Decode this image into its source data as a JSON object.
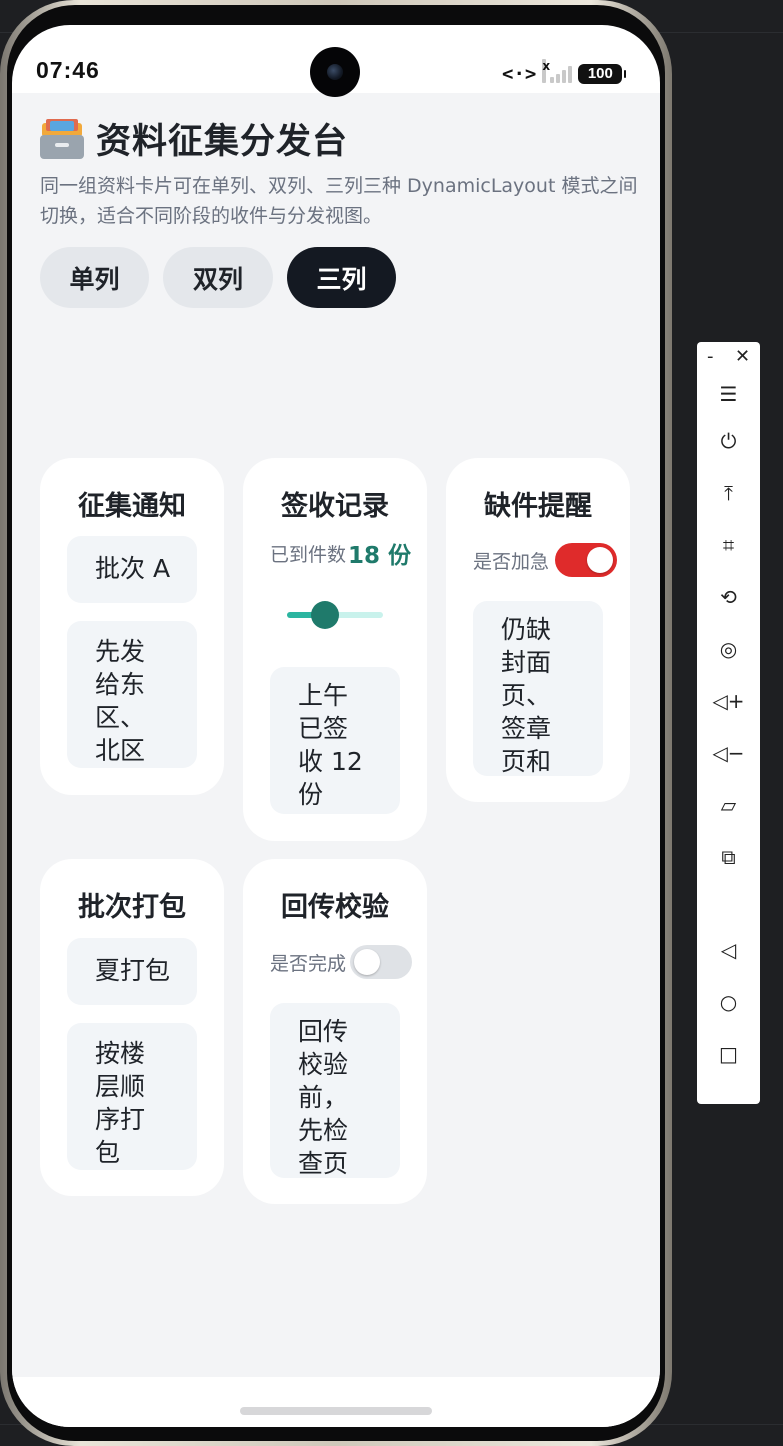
{
  "status_bar": {
    "time": "07:46",
    "network_icon": "<·>",
    "signal_x": "x",
    "battery": "100"
  },
  "header": {
    "icon": "card-file-box-icon",
    "title": "资料征集分发台",
    "subtitle": "同一组资料卡片可在单列、双列、三列三种 DynamicLayout 模式之间切换，适合不同阶段的收件与分发视图。"
  },
  "layout_buttons": [
    {
      "label": "单列",
      "selected": false
    },
    {
      "label": "双列",
      "selected": false
    },
    {
      "label": "三列",
      "selected": true
    }
  ],
  "cards": {
    "notice": {
      "title": "征集通知",
      "item1": "批次 A",
      "item2": "先发给东区、北区"
    },
    "receipt": {
      "title": "签收记录",
      "count_label": "已到件数",
      "count_value": "18 份",
      "slider_value": 0.35,
      "item1": "上午已签收 12 份"
    },
    "missing": {
      "title": "缺件提醒",
      "urgent_label": "是否加急",
      "urgent_on": true,
      "item1": "仍缺封面页、签章页和"
    },
    "packing": {
      "title": "批次打包",
      "item1": "夏打包",
      "item2": "按楼层顺序打包"
    },
    "verify": {
      "title": "回传校验",
      "done_label": "是否完成",
      "done_on": false,
      "item1": "回传校验前，先检查页"
    }
  },
  "emulator_toolbar": {
    "minimize": "-",
    "close": "✕",
    "buttons": [
      "menu-icon",
      "power-icon",
      "pin-top-icon",
      "crop-icon",
      "rotate-icon",
      "screenshot-icon",
      "volume-up-icon",
      "volume-down-icon",
      "shake-icon",
      "multi-device-icon",
      "back-icon",
      "home-icon",
      "recents-icon"
    ]
  },
  "colors": {
    "accent": "#141922",
    "teal": "#1f7a6b",
    "toggle_on": "#df2b2b"
  }
}
